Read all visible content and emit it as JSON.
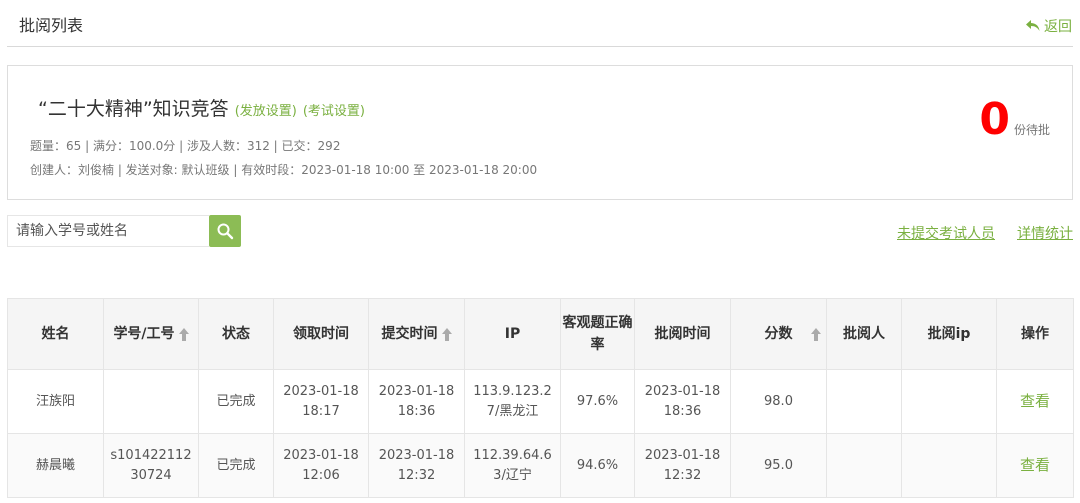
{
  "header": {
    "title": "批阅列表",
    "back_label": "返回"
  },
  "exam": {
    "title": "“二十大精神”知识竞答",
    "release_settings": "(发放设置)",
    "exam_settings": "(考试设置)",
    "stats": "题量：65 |  满分：100.0分 |  涉及人数：312 | 已交：292",
    "meta": "创建人：刘俊楠 | 发送对象:   默认班级   |  有效时段：2023-01-18 10:00 至 2023-01-18 20:00",
    "pending_count": "0",
    "pending_label": "份待批"
  },
  "search": {
    "placeholder": "请输入学号或姓名"
  },
  "links": {
    "unsubmitted": "未提交考试人员",
    "details": "详情统计"
  },
  "table": {
    "headers": {
      "name": "姓名",
      "id": "学号/工号",
      "status": "状态",
      "receive_time": "领取时间",
      "submit_time": "提交时间",
      "ip": "IP",
      "accuracy": "客观题正确率",
      "review_time": "批阅时间",
      "score": "分数",
      "reviewer": "批阅人",
      "reviewer_ip": "批阅ip",
      "action": "操作"
    },
    "rows": [
      {
        "name": "汪族阳",
        "id": "",
        "status": "已完成",
        "receive_time": "2023-01-18 18:17",
        "submit_time": "2023-01-18 18:36",
        "ip": "113.9.123.27/黑龙江",
        "accuracy": "97.6%",
        "review_time": "2023-01-18 18:36",
        "score": "98.0",
        "reviewer": "",
        "reviewer_ip": "",
        "action": "查看"
      },
      {
        "name": "赫晨曦",
        "id": "s10142211230724",
        "status": "已完成",
        "receive_time": "2023-01-18 12:06",
        "submit_time": "2023-01-18 12:32",
        "ip": "112.39.64.63/辽宁",
        "accuracy": "94.6%",
        "review_time": "2023-01-18 12:32",
        "score": "95.0",
        "reviewer": "",
        "reviewer_ip": "",
        "action": "查看"
      }
    ]
  },
  "colors": {
    "accent_green": "#7ab040",
    "search_button": "#8cbc55",
    "pending_red": "#ff0000"
  },
  "icons": {
    "back": "return-arrow-icon",
    "search": "search-icon",
    "sort": "sort-arrow-up-icon"
  }
}
